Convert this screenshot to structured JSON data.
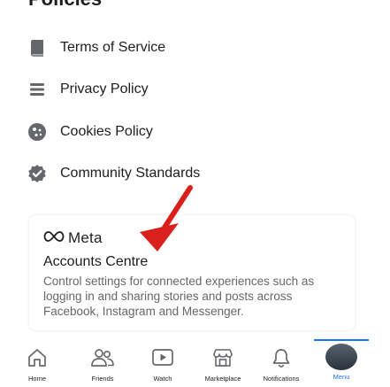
{
  "section": {
    "title": "Policies"
  },
  "policies": [
    {
      "label": "Terms of Service",
      "icon": "book-icon"
    },
    {
      "label": "Privacy Policy",
      "icon": "list-icon"
    },
    {
      "label": "Cookies Policy",
      "icon": "cookie-icon"
    },
    {
      "label": "Community Standards",
      "icon": "shield-check-icon"
    }
  ],
  "card": {
    "brand": "Meta",
    "title": "Accounts Centre",
    "description": "Control settings for connected experiences such as logging in and sharing stories and posts across Facebook, Instagram and Messenger."
  },
  "nav": {
    "items": [
      {
        "label": "Home",
        "icon": "home-icon"
      },
      {
        "label": "Friends",
        "icon": "friends-icon"
      },
      {
        "label": "Watch",
        "icon": "watch-icon"
      },
      {
        "label": "Marketplace",
        "icon": "marketplace-icon"
      },
      {
        "label": "Notifications",
        "icon": "bell-icon"
      },
      {
        "label": "Menu",
        "icon": "avatar"
      }
    ]
  },
  "colors": {
    "accent": "#1877f2",
    "annotation_arrow": "#d9201c",
    "icon_gray": "#65676b"
  }
}
